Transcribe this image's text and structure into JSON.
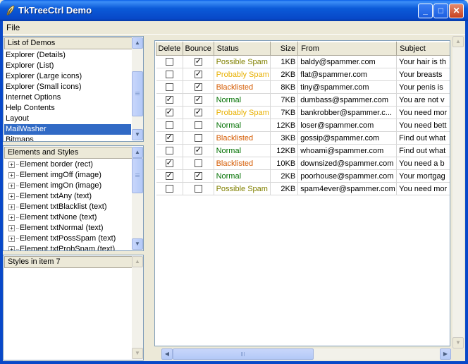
{
  "window": {
    "title": "TkTreeCtrl Demo"
  },
  "menu": {
    "file": "File"
  },
  "demos": {
    "header": "List of Demos",
    "items": [
      {
        "label": "Explorer (Details)",
        "selected": false
      },
      {
        "label": "Explorer (List)",
        "selected": false
      },
      {
        "label": "Explorer (Large icons)",
        "selected": false
      },
      {
        "label": "Explorer (Small icons)",
        "selected": false
      },
      {
        "label": "Internet Options",
        "selected": false
      },
      {
        "label": "Help Contents",
        "selected": false
      },
      {
        "label": "Layout",
        "selected": false
      },
      {
        "label": "MailWasher",
        "selected": true
      },
      {
        "label": "Bitmaps",
        "selected": false
      }
    ]
  },
  "elements": {
    "header": "Elements and Styles",
    "items": [
      "Element border (rect)",
      "Element imgOff (image)",
      "Element imgOn (image)",
      "Element txtAny (text)",
      "Element txtBlacklist (text)",
      "Element txtNone (text)",
      "Element txtNormal (text)",
      "Element txtPossSpam (text)",
      "Element txtProbSpam (text)"
    ]
  },
  "styles": {
    "header": "Styles in item 7"
  },
  "mail": {
    "columns": [
      "Delete",
      "Bounce",
      "Status",
      "Size",
      "From",
      "Subject"
    ],
    "status_colors": {
      "Possible Spam": "#808000",
      "Probably Spam": "#e8b000",
      "Blacklisted": "#d45a00",
      "Normal": "#007000"
    },
    "rows": [
      {
        "del": false,
        "bounce": true,
        "status": "Possible Spam",
        "size": "1KB",
        "from": "baldy@spammer.com",
        "subject": "Your hair is th"
      },
      {
        "del": false,
        "bounce": true,
        "status": "Probably Spam",
        "size": "2KB",
        "from": "flat@spammer.com",
        "subject": "Your breasts"
      },
      {
        "del": false,
        "bounce": true,
        "status": "Blacklisted",
        "size": "8KB",
        "from": "tiny@spammer.com",
        "subject": "Your penis is"
      },
      {
        "del": true,
        "bounce": true,
        "status": "Normal",
        "size": "7KB",
        "from": "dumbass@spammer.com",
        "subject": "You are not v"
      },
      {
        "del": true,
        "bounce": true,
        "status": "Probably Spam",
        "size": "7KB",
        "from": "bankrobber@spammer.c...",
        "subject": "You need mor"
      },
      {
        "del": false,
        "bounce": false,
        "status": "Normal",
        "size": "12KB",
        "from": "loser@spammer.com",
        "subject": "You need bett"
      },
      {
        "del": true,
        "bounce": false,
        "status": "Blacklisted",
        "size": "3KB",
        "from": "gossip@spammer.com",
        "subject": "Find out what"
      },
      {
        "del": false,
        "bounce": true,
        "status": "Normal",
        "size": "12KB",
        "from": "whoami@spammer.com",
        "subject": "Find out what"
      },
      {
        "del": true,
        "bounce": false,
        "status": "Blacklisted",
        "size": "10KB",
        "from": "downsized@spammer.com",
        "subject": "You need a b"
      },
      {
        "del": true,
        "bounce": true,
        "status": "Normal",
        "size": "2KB",
        "from": "poorhouse@spammer.com",
        "subject": "Your mortgag"
      },
      {
        "del": false,
        "bounce": false,
        "status": "Possible Spam",
        "size": "2KB",
        "from": "spam4ever@spammer.com",
        "subject": "You need mor"
      }
    ]
  }
}
